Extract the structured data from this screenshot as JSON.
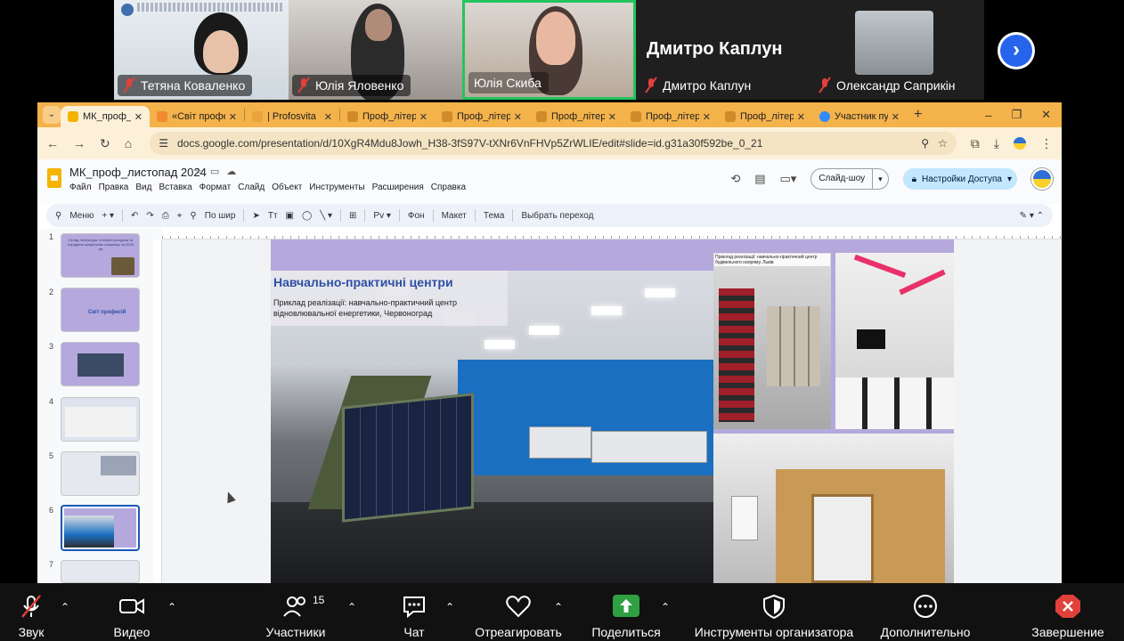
{
  "participants": [
    {
      "name": "Тетяна  Коваленко",
      "muted": true
    },
    {
      "name": "Юлія Яловенко",
      "muted": true
    },
    {
      "name": "Юлія Скиба",
      "muted": false,
      "active_speaker": true
    },
    {
      "name": "Дмитро Каплун",
      "muted": true,
      "display_name_large": "Дмитро Каплун"
    },
    {
      "name": "Олександр Саприкін",
      "muted": true
    }
  ],
  "browser": {
    "tabs": [
      {
        "label": "МК_проф_ли",
        "active": true,
        "favicon_color": "#f4b400"
      },
      {
        "label": "«Світ профе",
        "favicon_color": "#f28b30"
      },
      {
        "label": "| Profosvita",
        "favicon_color": "#e8a33a"
      },
      {
        "label": "Проф_літера",
        "favicon_color": "#d08a2a"
      },
      {
        "label": "Проф_літера",
        "favicon_color": "#d08a2a"
      },
      {
        "label": "Проф_літера",
        "favicon_color": "#d08a2a"
      },
      {
        "label": "Проф_літера",
        "favicon_color": "#d08a2a"
      },
      {
        "label": "Проф_літера",
        "favicon_color": "#d08a2a"
      },
      {
        "label": "Участник пу",
        "favicon_color": "#2d8cff"
      }
    ],
    "close_glyph": "✕",
    "new_tab_glyph": "+",
    "window_controls": [
      "–",
      "❐",
      "✕"
    ],
    "url": "docs.google.com/presentation/d/10XgR4Mdu8Jowh_H38-3fS97V-tXNr6VnFHVp5ZrWLIE/edit#slide=id.g31a30f592be_0_21"
  },
  "docs": {
    "title": "МК_проф_листопад 2024",
    "menu": [
      "Файл",
      "Правка",
      "Вид",
      "Вставка",
      "Формат",
      "Слайд",
      "Объект",
      "Инструменты",
      "Расширения",
      "Справка"
    ],
    "slideshow_label": "Слайд-шоу",
    "share_label": "Настройки Доступа",
    "toolbar": {
      "menu_label": "Меню",
      "zoom_label": "По шир",
      "background_label": "Фон",
      "layout_label": "Макет",
      "theme_label": "Тема",
      "transition_label": "Выбрать переход"
    },
    "thumbnails": [
      {
        "num": "1",
        "caption": "Огляд літератури, інтернет-ресурсів та порадник профільних напрямку за 2024 рік"
      },
      {
        "num": "2",
        "caption": "Світ професій"
      },
      {
        "num": "3",
        "caption": ""
      },
      {
        "num": "4",
        "caption": ""
      },
      {
        "num": "5",
        "caption": ""
      },
      {
        "num": "6",
        "caption": "",
        "selected": true
      },
      {
        "num": "7",
        "caption": ""
      }
    ]
  },
  "slide": {
    "title": "Навчально-практичні центри",
    "subtitle": "Приклад реалізації: навчально-практичний центр відновлювальної енергетики, Червоноград",
    "caption_small": "Приклад реалізації: навчально-практичний центр будівельного напряму, Львів"
  },
  "controls": [
    {
      "label": "Звук",
      "icon": "mic-muted-icon"
    },
    {
      "label": "Видео",
      "icon": "video-camera-icon"
    },
    {
      "label": "Участники",
      "icon": "participants-icon",
      "count": "15"
    },
    {
      "label": "Чат",
      "icon": "chat-icon"
    },
    {
      "label": "Отреагировать",
      "icon": "heart-icon"
    },
    {
      "label": "Поделиться",
      "icon": "share-screen-icon"
    },
    {
      "label": "Инструменты организатора",
      "icon": "shield-icon"
    },
    {
      "label": "Дополнительно",
      "icon": "more-icon"
    },
    {
      "label": "Завершение",
      "icon": "end-icon"
    }
  ],
  "colors": {
    "tab_bar": "#f4b24a",
    "active_speaker_border": "#22c55e",
    "slide_accent": "#b4a8dc",
    "slide_title": "#2e4fa3",
    "share_button": "#2ea043",
    "end_red": "#e0413a"
  }
}
